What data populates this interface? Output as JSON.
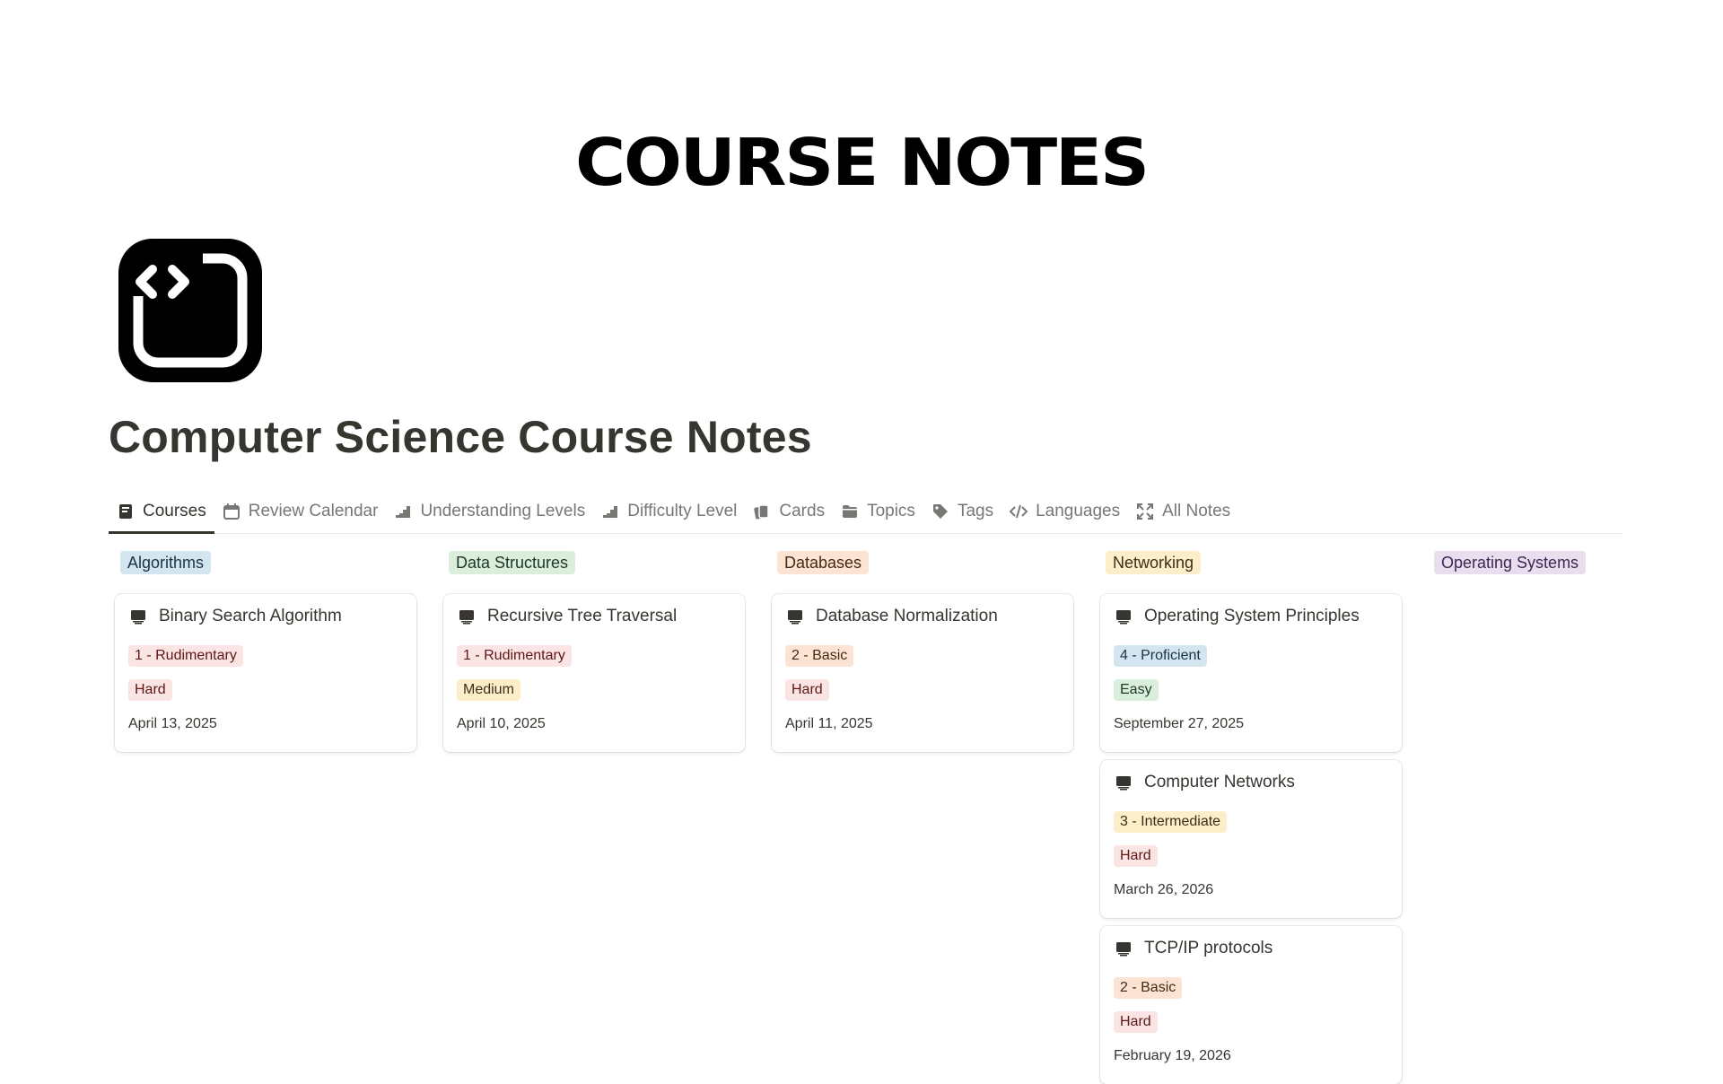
{
  "banner": {
    "title": "COURSE NOTES"
  },
  "page": {
    "icon": "code-window-icon",
    "title": "Computer Science Course Notes"
  },
  "tabs": [
    {
      "label": "Courses",
      "icon": "notebook-icon",
      "active": true
    },
    {
      "label": "Review Calendar",
      "icon": "calendar-icon"
    },
    {
      "label": "Understanding Levels",
      "icon": "stairs-icon"
    },
    {
      "label": "Difficulty Level",
      "icon": "stairs-icon"
    },
    {
      "label": "Cards",
      "icon": "cards-icon"
    },
    {
      "label": "Topics",
      "icon": "folder-icon"
    },
    {
      "label": "Tags",
      "icon": "tag-icon"
    },
    {
      "label": "Languages",
      "icon": "code-icon"
    },
    {
      "label": "All Notes",
      "icon": "expand-icon"
    }
  ],
  "colors": {
    "tag_red_bg": "#fbe4e4",
    "tag_red_text": "#5d1715",
    "tag_orange_bg": "#fbe4d4",
    "tag_orange_text": "#49290e",
    "tag_yellow_bg": "#fbeec8",
    "tag_yellow_text": "#402c1b",
    "tag_blue_bg": "#d3e5ef",
    "tag_blue_text": "#183347",
    "tag_green_bg": "#dbeddb",
    "tag_green_text": "#1c3829",
    "tag_purple_bg": "#e8deee",
    "tag_purple_text": "#412454"
  },
  "board": {
    "columns": [
      {
        "label": "Algorithms",
        "color": "#d3e5ef",
        "cards": [
          {
            "title": "Binary Search Algorithm",
            "icon": "computer-icon",
            "understanding": "1 - Rudimentary",
            "understanding_color": "red",
            "difficulty": "Hard",
            "difficulty_color": "red",
            "date": "April 13, 2025"
          }
        ]
      },
      {
        "label": "Data Structures",
        "color": "#dbeddb",
        "cards": [
          {
            "title": "Recursive Tree Traversal",
            "icon": "computer-icon",
            "understanding": "1 - Rudimentary",
            "understanding_color": "red",
            "difficulty": "Medium",
            "difficulty_color": "yellow",
            "date": "April 10, 2025"
          }
        ]
      },
      {
        "label": "Databases",
        "color": "#fbe4d4",
        "cards": [
          {
            "title": "Database Normalization",
            "icon": "computer-icon",
            "understanding": "2 - Basic",
            "understanding_color": "orange",
            "difficulty": "Hard",
            "difficulty_color": "red",
            "date": "April 11, 2025"
          }
        ]
      },
      {
        "label": "Networking",
        "color": "#fbeec8",
        "cards": [
          {
            "title": "Operating System Principles",
            "icon": "computer-icon",
            "understanding": "4 - Proficient",
            "understanding_color": "blue",
            "difficulty": "Easy",
            "difficulty_color": "green",
            "date": "September 27, 2025"
          },
          {
            "title": "Computer Networks",
            "icon": "computer-icon",
            "understanding": "3 - Intermediate",
            "understanding_color": "yellow",
            "difficulty": "Hard",
            "difficulty_color": "red",
            "date": "March 26, 2026"
          },
          {
            "title": "TCP/IP protocols",
            "icon": "computer-icon",
            "understanding": "2 - Basic",
            "understanding_color": "orange",
            "difficulty": "Hard",
            "difficulty_color": "red",
            "date": "February 19, 2026"
          }
        ]
      },
      {
        "label": "Operating Systems",
        "color": "#e8deee",
        "cards": []
      }
    ]
  }
}
